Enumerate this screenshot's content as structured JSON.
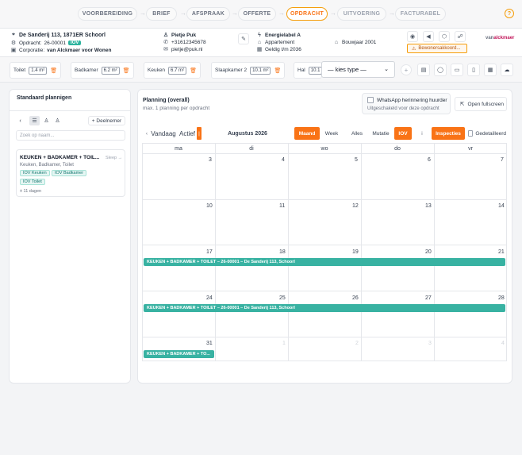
{
  "steps": [
    "VOORBEREIDING",
    "BRIEF",
    "AFSPRAAK",
    "OFFERTE",
    "OPDRACHT",
    "UITVOERING",
    "FACTURABEL"
  ],
  "active_step": "OPDRACHT",
  "info": {
    "address": "De Sanderij 113, 1871ER Schoorl",
    "opdracht_label": "Opdracht:",
    "opdracht_nr": "26-00001",
    "opdracht_badge": "IOV",
    "corporatie_label": "Corporatie:",
    "corporatie": "van Alckmaer voor Wonen",
    "name": "Pietje Puk",
    "phone": "+31612345678",
    "email": "pietje@puk.nl",
    "energielabel": "Energielabel A",
    "type": "Appartement",
    "geldig": "Geldig t/m 2036",
    "bouwjaar": "Bouwjaar 2001",
    "bewonersakkoord": "Bewonersakkoord...",
    "logo_primary": "van",
    "logo_secondary": "alckmaer"
  },
  "rooms": [
    {
      "name": "Toilet",
      "value": "1.4 m²"
    },
    {
      "name": "Badkamer",
      "value": "6.2 m²"
    },
    {
      "name": "Keuken",
      "value": "6.7 m²"
    },
    {
      "name": "Slaapkamer 2",
      "value": "10.1 m²"
    },
    {
      "name": "Hal",
      "value": "10.1"
    }
  ],
  "room_select": "— kies type —",
  "left_panel": {
    "title": "Standaard plannigen",
    "deelnemer": "+ Deelnemer",
    "search_placeholder": "Zoek op naam...",
    "card_title": "KEUKEN + BADKAMER + TOIL...",
    "card_drag": "Sleep →",
    "card_subtitle": "Keuken, Badkamer, Toilet",
    "card_tags": [
      "IOV Keuken",
      "IOV Badkamer",
      "IOV Toilet"
    ],
    "card_duration": "± 11 dagen"
  },
  "planning": {
    "title": "Planning (overall)",
    "subtitle": "max. 1 planning per opdracht",
    "whatsapp": "WhatsApp herinnering huurder",
    "whatsapp_note": "Uitgeschakeld voor deze opdracht",
    "fullscreen": "Open fullscreen",
    "vandaag": "Vandaag",
    "actief": "Actief",
    "month": "Augustus 2026",
    "view_maand": "Maand",
    "view_week": "Week",
    "filter_alles": "Alles",
    "filter_mutatie": "Mutatie",
    "filter_iov": "IOV",
    "inspecties": "Inspecties",
    "gedetailleerd": "Gedetailleerd",
    "days": [
      "ma",
      "di",
      "wo",
      "do",
      "vr"
    ],
    "weeks": [
      [
        "",
        "",
        "",
        "",
        ""
      ],
      [
        "3",
        "4",
        "5",
        "6",
        "7"
      ],
      [
        "10",
        "11",
        "12",
        "13",
        "14"
      ],
      [
        "17",
        "18",
        "19",
        "20",
        "21"
      ],
      [
        "24",
        "25",
        "26",
        "27",
        "28"
      ],
      [
        "31",
        "1",
        "2",
        "3",
        "4"
      ]
    ],
    "event_full": "KEUKEN + BADKAMER + TOILET – 26-00001 – De Sanderij 113, Schoorl",
    "event_short": "KEUKEN + BADKAMER + TO..."
  }
}
